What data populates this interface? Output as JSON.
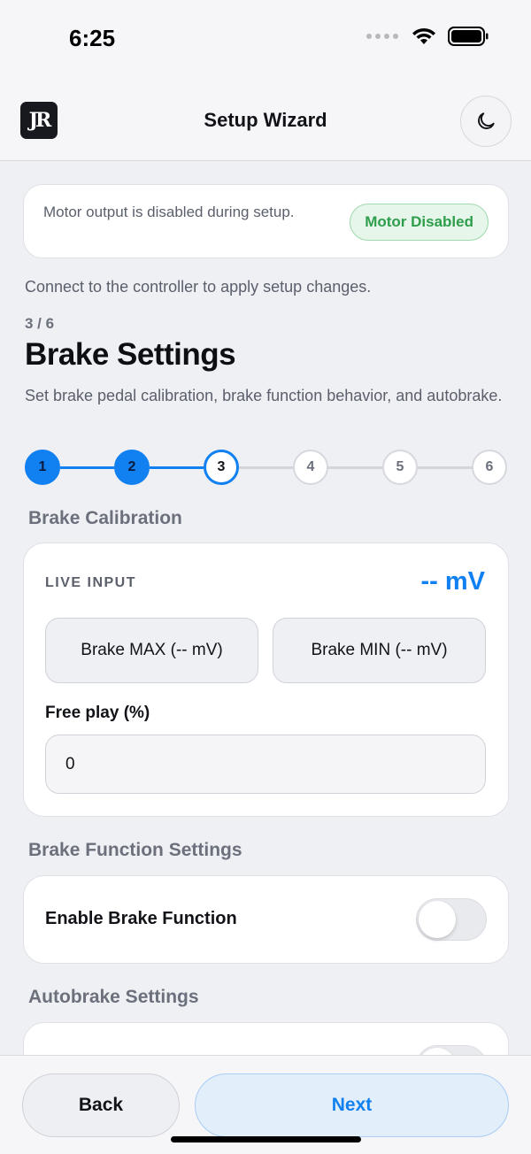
{
  "status_bar": {
    "time": "6:25"
  },
  "header": {
    "logo_text": "JR",
    "title": "Setup Wizard",
    "theme_icon": "moon-icon"
  },
  "notice": {
    "text": "Motor output is disabled during setup.",
    "badge": "Motor Disabled"
  },
  "connect_message": "Connect to the controller to apply setup changes.",
  "step": {
    "count": "3 / 6",
    "title": "Brake Settings",
    "description": "Set brake pedal calibration, brake function behavior, and autobrake.",
    "steps": [
      {
        "label": "1",
        "state": "done"
      },
      {
        "label": "2",
        "state": "done"
      },
      {
        "label": "3",
        "state": "current"
      },
      {
        "label": "4",
        "state": "pending"
      },
      {
        "label": "5",
        "state": "pending"
      },
      {
        "label": "6",
        "state": "pending"
      }
    ]
  },
  "calibration": {
    "section_title": "Brake Calibration",
    "live_label": "LIVE INPUT",
    "live_value": "-- mV",
    "max_button": "Brake MAX (-- mV)",
    "min_button": "Brake MIN (-- mV)",
    "free_play_label": "Free play (%)",
    "free_play_value": "0"
  },
  "brake_function": {
    "section_title": "Brake Function Settings",
    "enable_label": "Enable Brake Function",
    "enabled": false
  },
  "autobrake": {
    "section_title": "Autobrake Settings",
    "enabled": false
  },
  "footer": {
    "back": "Back",
    "next": "Next"
  },
  "colors": {
    "accent": "#1180f0",
    "success": "#2e9e4c",
    "background": "#eff0f4"
  }
}
